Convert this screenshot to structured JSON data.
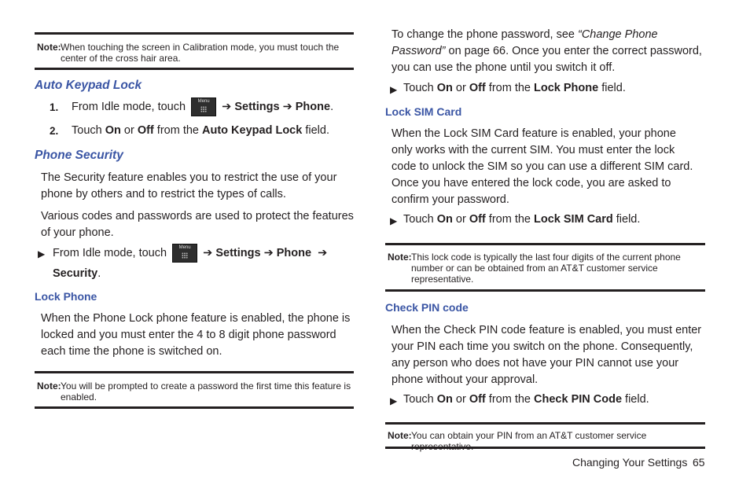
{
  "left": {
    "note1": {
      "label": "Note:",
      "text": "When touching the screen in Calibration mode, you must touch the center of the cross hair area."
    },
    "auto_keypad": {
      "heading": "Auto Keypad Lock",
      "step1": {
        "num": "1.",
        "pre": "From Idle mode, touch",
        "icon_label": "Menu",
        "arrow": "➔",
        "s1": "Settings",
        "s2": "Phone",
        "end": "."
      },
      "step2": {
        "num": "2.",
        "t1": "Touch ",
        "on": "On",
        "t2": " or ",
        "off": "Off",
        "t3": " from the ",
        "field": "Auto Keypad Lock",
        "t4": " field."
      }
    },
    "phone_security": {
      "heading": "Phone Security",
      "para1": "The Security feature enables you to restrict the use of your phone by others and to restrict the types of calls.",
      "para2": "Various codes and passwords are used to protect the features of your phone.",
      "bullet": {
        "pre": "From Idle mode, touch",
        "icon_label": "Menu",
        "arrow": "➔",
        "s1": "Settings",
        "s2": "Phone",
        "s3": "Security",
        "end": "."
      }
    },
    "lock_phone": {
      "heading": "Lock Phone",
      "para": "When the Phone Lock phone feature is enabled, the phone is locked and you must enter the 4 to 8 digit phone password each time the phone is switched on."
    },
    "note2": {
      "label": "Note:",
      "text": "You will be prompted to create a password the first time this feature is enabled."
    }
  },
  "right": {
    "para_top": {
      "t1": "To change the phone password, see ",
      "ref": "“Change Phone Password”",
      "t2": " on page 66. Once you enter the correct password, you can use the phone until you switch it off."
    },
    "bullet1": {
      "t1": "Touch ",
      "on": "On",
      "t2": " or ",
      "off": "Off",
      "t3": " from the ",
      "field": "Lock Phone",
      "t4": " field."
    },
    "lock_sim": {
      "heading": "Lock SIM Card",
      "para": "When the Lock SIM Card feature is enabled, your phone only works with the current SIM. You must enter the lock code to unlock the SIM so you can use a different SIM card. Once you have entered the lock code, you are asked to confirm your password.",
      "bullet": {
        "t1": "Touch ",
        "on": "On",
        "t2": " or ",
        "off": "Off",
        "t3": " from the ",
        "field": "Lock SIM Card",
        "t4": " field."
      }
    },
    "note3": {
      "label": "Note:",
      "text": "This lock code is typically the last four digits of the current phone number or can be obtained from an AT&T customer service representative."
    },
    "check_pin": {
      "heading": "Check PIN code",
      "para": "When the Check PIN code feature is enabled, you must enter your PIN each time you switch on the phone. Consequently, any person who does not have your PIN cannot use your phone without your approval.",
      "bullet": {
        "t1": "Touch ",
        "on": "On",
        "t2": " or ",
        "off": "Off",
        "t3": " from the ",
        "field": "Check PIN Code",
        "t4": " field."
      }
    },
    "note4": {
      "label": "Note:",
      "text": "You can obtain your PIN from an AT&T customer service representative."
    }
  },
  "footer": {
    "section": "Changing Your Settings",
    "page": "65"
  },
  "colors": {
    "heading": "#3a55a4",
    "text": "#231f20"
  }
}
